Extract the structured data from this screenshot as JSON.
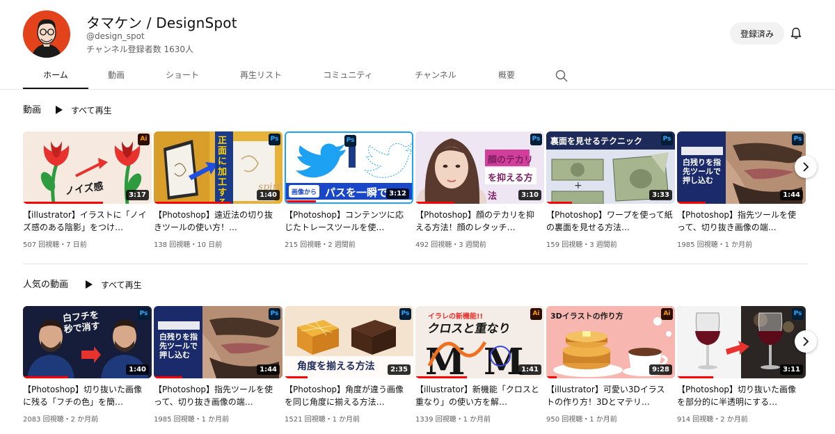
{
  "channel": {
    "name": "タマケン / DesignSpot",
    "handle": "@design_spot",
    "subscribers": "チャンネル登録者数 1630人",
    "subscribe_label": "登録済み",
    "avatar_bg": "#e2431b"
  },
  "tabs": [
    {
      "label": "ホーム",
      "active": true
    },
    {
      "label": "動画"
    },
    {
      "label": "ショート"
    },
    {
      "label": "再生リスト"
    },
    {
      "label": "コミュニティ"
    },
    {
      "label": "チャンネル"
    },
    {
      "label": "概要"
    }
  ],
  "shelves": [
    {
      "title": "動画",
      "play_all": "すべて再生",
      "videos": [
        {
          "title": "【illustrator】イラストに「ノイズ感のある陰影」をつけ…",
          "meta": "507 回視聴・7 日前",
          "duration": "3:17",
          "badge": "Ai",
          "thumb_text": "ノイズ感",
          "bg": "#f6e9df"
        },
        {
          "title": "【Photoshop】遠近法の切り抜きツールの使い方！…",
          "meta": "138 回視聴・10 日前",
          "duration": "1:40",
          "badge": "Ps",
          "thumb_text": "正面に加工する",
          "bg": "#e7b23a"
        },
        {
          "title": "【Photoshop】コンテンツに応じたトレースツールを使…",
          "meta": "215 回視聴・2 週間前",
          "duration": "3:12",
          "badge": "Ps",
          "thumb_text": "パスを一瞬で",
          "bg": "#ffffff"
        },
        {
          "title": "【Photoshop】顔のテカリを抑える方法！顔のレタッチ…",
          "meta": "492 回視聴・3 週間前",
          "duration": "3:10",
          "badge": "Ps",
          "thumb_text": "顔のテカリを抑える方法",
          "bg": "#efe6f3"
        },
        {
          "title": "【Photoshop】ワープを使って紙の裏面を見せる方法…",
          "meta": "159 回視聴・3 週間前",
          "duration": "3:33",
          "badge": "Ps",
          "thumb_text": "裏面を見せるテクニック",
          "bg": "#dfe3f0"
        },
        {
          "title": "【Photoshop】指先ツールを使って、切り抜き画像の端…",
          "meta": "1985 回視聴・1 か月前",
          "duration": "1:44",
          "badge": "Ps",
          "thumb_text": "白残りを指先ツールで押し込む",
          "bg": "#1a2a6b"
        }
      ]
    },
    {
      "title": "人気の動画",
      "play_all": "すべて再生",
      "videos": [
        {
          "title": "【Photoshop】切り抜いた画像に残る「フチの色」を簡…",
          "meta": "2083 回視聴・2 か月前",
          "duration": "1:40",
          "badge": "Ps",
          "thumb_text": "白フチを秒で消す",
          "bg": "#151d3a"
        },
        {
          "title": "【Photoshop】指先ツールを使って、切り抜き画像の端…",
          "meta": "1985 回視聴・1 か月前",
          "duration": "1:44",
          "badge": "Ps",
          "thumb_text": "白残りを指先ツールで押し込む",
          "bg": "#1a2a6b"
        },
        {
          "title": "【Photoshop】角度が違う画像を同じ角度に揃える方法…",
          "meta": "1521 回視聴・1 か月前",
          "duration": "2:35",
          "badge": "Ps",
          "thumb_text": "角度を揃える方法",
          "bg": "#f3e3cf"
        },
        {
          "title": "【illustrator】新機能「クロスと重なり」の使い方を解…",
          "meta": "1339 回視聴・1 か月前",
          "duration": "1:41",
          "badge": "Ai",
          "thumb_text": "クロスと重なり",
          "bg": "#f4ece6"
        },
        {
          "title": "【illustrator】可愛い3Dイラストの作り方！3Dとマテリ…",
          "meta": "950 回視聴・1 か月前",
          "duration": "9:28",
          "badge": "Ai",
          "thumb_text": "3Dイラストの作り方",
          "bg": "#f7b6b0"
        },
        {
          "title": "【Photoshop】切り抜いた画像を部分的に半透明にする…",
          "meta": "914 回視聴・2 か月前",
          "duration": "3:11",
          "badge": "Ps",
          "thumb_text": "",
          "bg": "#2b2523"
        }
      ]
    }
  ]
}
